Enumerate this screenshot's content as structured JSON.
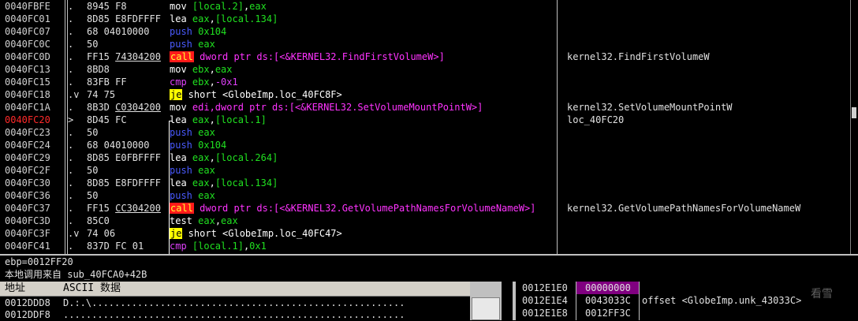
{
  "disasm": {
    "rows": [
      {
        "addr": "0040FBFE",
        "arrow": ".",
        "hex": "8945 F8",
        "hexu": "",
        "tokens": [
          [
            "mov",
            "mov "
          ],
          [
            "op",
            "[local.2]"
          ],
          [
            "plain",
            ","
          ],
          [
            "op",
            "eax"
          ]
        ],
        "comment": ""
      },
      {
        "addr": "0040FC01",
        "arrow": ".",
        "hex": "8D85 E8FDFFFF",
        "hexu": "",
        "tokens": [
          [
            "plain",
            "lea "
          ],
          [
            "op",
            "eax"
          ],
          [
            "plain",
            ","
          ],
          [
            "op",
            "[local.134]"
          ]
        ],
        "comment": ""
      },
      {
        "addr": "0040FC07",
        "arrow": ".",
        "hex": "68 04010000",
        "hexu": "",
        "tokens": [
          [
            "push",
            "push "
          ],
          [
            "op",
            "0x104"
          ]
        ],
        "comment": ""
      },
      {
        "addr": "0040FC0C",
        "arrow": ".",
        "hex": "50",
        "hexu": "",
        "tokens": [
          [
            "push",
            "push "
          ],
          [
            "op",
            "eax"
          ]
        ],
        "comment": ""
      },
      {
        "addr": "0040FC0D",
        "arrow": ".",
        "hex": "FF15 ",
        "hexu": "74304200",
        "tokens": [
          [
            "call",
            "call"
          ],
          [
            "plain",
            " "
          ],
          [
            "ct",
            "dword ptr ds:[<&KERNEL32.FindFirstVolumeW>]"
          ]
        ],
        "comment": "kernel32.FindFirstVolumeW"
      },
      {
        "addr": "0040FC13",
        "arrow": ".",
        "hex": "8BD8",
        "hexu": "",
        "tokens": [
          [
            "mov",
            "mov "
          ],
          [
            "op",
            "ebx"
          ],
          [
            "plain",
            ","
          ],
          [
            "op",
            "eax"
          ]
        ],
        "comment": ""
      },
      {
        "addr": "0040FC15",
        "arrow": ".",
        "hex": "83FB FF",
        "hexu": "",
        "tokens": [
          [
            "cmp",
            "cmp "
          ],
          [
            "op",
            "ebx"
          ],
          [
            "plain",
            ","
          ],
          [
            "cmp",
            "-0x1"
          ]
        ],
        "comment": ""
      },
      {
        "addr": "0040FC18",
        "arrow": ".v",
        "hex": "74 75",
        "hexu": "",
        "tokens": [
          [
            "je",
            "je"
          ],
          [
            "plain",
            " short <GlobeImp.loc_40FC8F>"
          ]
        ],
        "comment": ""
      },
      {
        "addr": "0040FC1A",
        "arrow": ".",
        "hex": "8B3D ",
        "hexu": "C0304200",
        "tokens": [
          [
            "mov",
            "mov "
          ],
          [
            "ct",
            "edi,dword ptr ds:[<&KERNEL32.SetVolumeMountPointW>]"
          ]
        ],
        "comment": "kernel32.SetVolumeMountPointW"
      },
      {
        "addr": "0040FC20",
        "arrow": ">",
        "hex": "8D45 FC",
        "hexu": "",
        "tokens": [
          [
            "plain",
            "lea "
          ],
          [
            "op",
            "eax"
          ],
          [
            "plain",
            ","
          ],
          [
            "op",
            "[local.1]"
          ]
        ],
        "comment": "loc_40FC20",
        "hl": true
      },
      {
        "addr": "0040FC23",
        "arrow": ".",
        "hex": "50",
        "hexu": "",
        "tokens": [
          [
            "push",
            "push "
          ],
          [
            "op",
            "eax"
          ]
        ],
        "comment": ""
      },
      {
        "addr": "0040FC24",
        "arrow": ".",
        "hex": "68 04010000",
        "hexu": "",
        "tokens": [
          [
            "push",
            "push "
          ],
          [
            "op",
            "0x104"
          ]
        ],
        "comment": ""
      },
      {
        "addr": "0040FC29",
        "arrow": ".",
        "hex": "8D85 E0FBFFFF",
        "hexu": "",
        "tokens": [
          [
            "plain",
            "lea "
          ],
          [
            "op",
            "eax"
          ],
          [
            "plain",
            ","
          ],
          [
            "op",
            "[local.264]"
          ]
        ],
        "comment": ""
      },
      {
        "addr": "0040FC2F",
        "arrow": ".",
        "hex": "50",
        "hexu": "",
        "tokens": [
          [
            "push",
            "push "
          ],
          [
            "op",
            "eax"
          ]
        ],
        "comment": ""
      },
      {
        "addr": "0040FC30",
        "arrow": ".",
        "hex": "8D85 E8FDFFFF",
        "hexu": "",
        "tokens": [
          [
            "plain",
            "lea "
          ],
          [
            "op",
            "eax"
          ],
          [
            "plain",
            ","
          ],
          [
            "op",
            "[local.134]"
          ]
        ],
        "comment": ""
      },
      {
        "addr": "0040FC36",
        "arrow": ".",
        "hex": "50",
        "hexu": "",
        "tokens": [
          [
            "push",
            "push "
          ],
          [
            "op",
            "eax"
          ]
        ],
        "comment": ""
      },
      {
        "addr": "0040FC37",
        "arrow": ".",
        "hex": "FF15 ",
        "hexu": "CC304200",
        "tokens": [
          [
            "call",
            "call"
          ],
          [
            "plain",
            " "
          ],
          [
            "ct",
            "dword ptr ds:[<&KERNEL32.GetVolumePathNamesForVolumeNameW>]"
          ]
        ],
        "comment": "kernel32.GetVolumePathNamesForVolumeNameW"
      },
      {
        "addr": "0040FC3D",
        "arrow": ".",
        "hex": "85C0",
        "hexu": "",
        "tokens": [
          [
            "test",
            "test "
          ],
          [
            "op",
            "eax"
          ],
          [
            "plain",
            ","
          ],
          [
            "op",
            "eax"
          ]
        ],
        "comment": ""
      },
      {
        "addr": "0040FC3F",
        "arrow": ".v",
        "hex": "74 06",
        "hexu": "",
        "tokens": [
          [
            "je",
            "je"
          ],
          [
            "plain",
            " short <GlobeImp.loc_40FC47>"
          ]
        ],
        "comment": ""
      },
      {
        "addr": "0040FC41",
        "arrow": ".",
        "hex": "837D FC 01",
        "hexu": "",
        "tokens": [
          [
            "cmp",
            "cmp "
          ],
          [
            "op",
            "[local.1]"
          ],
          [
            "plain",
            ","
          ],
          [
            "op",
            "0x1"
          ]
        ],
        "comment": ""
      }
    ]
  },
  "info": {
    "line1": "ebp=0012FF20",
    "line2": "本地调用来自  sub_40FCA0+42B"
  },
  "dump": {
    "col_addr": "地址",
    "col_ascii": "ASCII 数据",
    "rows": [
      {
        "addr": "0012DDD8",
        "ascii": "D.:.\\......................................................."
      },
      {
        "addr": "0012DDF8",
        "ascii": "............................................................"
      }
    ]
  },
  "stack": {
    "rows": [
      {
        "addr": "0012E1E0",
        "val": "00000000",
        "cmt": "",
        "sel": true
      },
      {
        "addr": "0012E1E4",
        "val": "0043033C",
        "cmt": "offset <GlobeImp.unk_43033C>",
        "sel": false
      },
      {
        "addr": "0012E1E8",
        "val": "0012FF3C",
        "cmt": "",
        "sel": false
      }
    ]
  },
  "watermark": "看雪"
}
